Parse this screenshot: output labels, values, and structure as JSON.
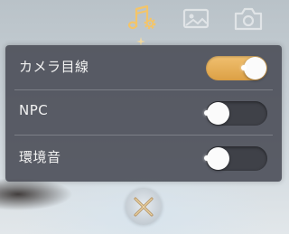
{
  "tabs": [
    {
      "id": "sound",
      "icon": "music-settings-icon",
      "active": true
    },
    {
      "id": "camera",
      "icon": "image-settings-icon",
      "active": false
    },
    {
      "id": "screenshot",
      "icon": "camera-icon",
      "active": false
    }
  ],
  "settings": [
    {
      "label": "カメラ目線",
      "on": true
    },
    {
      "label": "NPC",
      "on": false
    },
    {
      "label": "環境音",
      "on": false
    }
  ],
  "colors": {
    "toggle_on": "#e2aa52",
    "toggle_off": "#3f4148",
    "panel": "#484a54",
    "accent": "#f3c56a"
  },
  "close_icon": "close-icon"
}
